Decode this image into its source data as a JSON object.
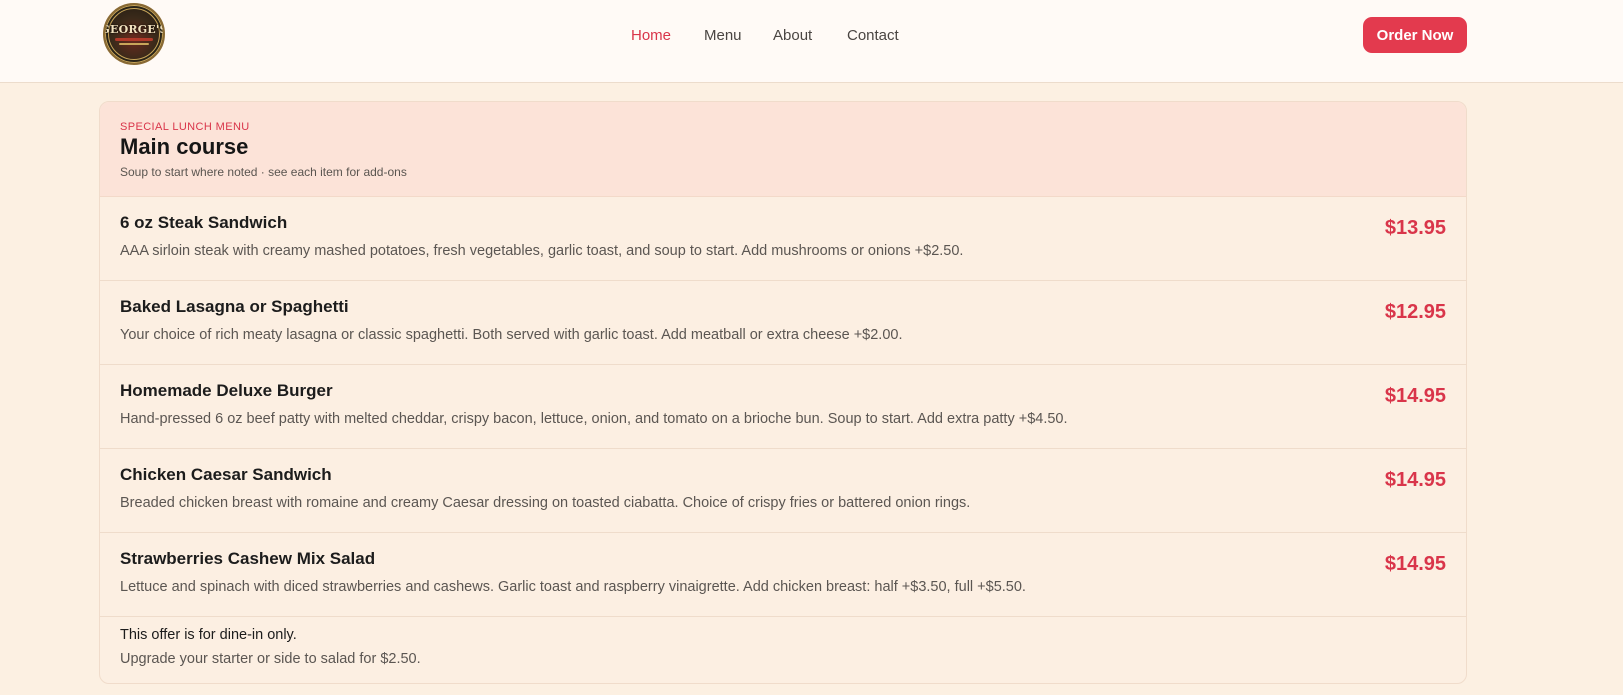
{
  "brand": {
    "logo_text": "GEORGE'S"
  },
  "nav": {
    "items": [
      {
        "label": "Home",
        "active": true
      },
      {
        "label": "Menu",
        "active": false
      },
      {
        "label": "About",
        "active": false
      },
      {
        "label": "Contact",
        "active": false
      }
    ],
    "cta_label": "Order Now"
  },
  "menu": {
    "eyebrow": "SPECIAL LUNCH MENU",
    "title": "Main course",
    "subtitle": "Soup to start where noted · see each item for add-ons",
    "items": [
      {
        "name": "6 oz Steak Sandwich",
        "description": "AAA sirloin steak with creamy mashed potatoes, fresh vegetables, garlic toast, and soup to start. Add mushrooms or onions +$2.50.",
        "price": "$13.95"
      },
      {
        "name": "Baked Lasagna or Spaghetti",
        "description": "Your choice of rich meaty lasagna or classic spaghetti. Both served with garlic toast. Add meatball or extra cheese +$2.00.",
        "price": "$12.95"
      },
      {
        "name": "Homemade Deluxe Burger",
        "description": "Hand-pressed 6 oz beef patty with melted cheddar, crispy bacon, lettuce, onion, and tomato on a brioche bun. Soup to start. Add extra patty +$4.50.",
        "price": "$14.95"
      },
      {
        "name": "Chicken Caesar Sandwich",
        "description": "Breaded chicken breast with romaine and creamy Caesar dressing on toasted ciabatta. Choice of crispy fries or battered onion rings.",
        "price": "$14.95"
      },
      {
        "name": "Strawberries Cashew Mix Salad",
        "description": "Lettuce and spinach with diced strawberries and cashews. Garlic toast and raspberry vinaigrette. Add chicken breast: half +$3.50, full +$5.50.",
        "price": "$14.95"
      }
    ],
    "note_1": "This offer is for dine-in only.",
    "note_2": "Upgrade your starter or side to salad for $2.50."
  },
  "colors": {
    "accent": "#e33a4e",
    "background": "#fcf0e2",
    "header_band": "#fce3d8"
  }
}
